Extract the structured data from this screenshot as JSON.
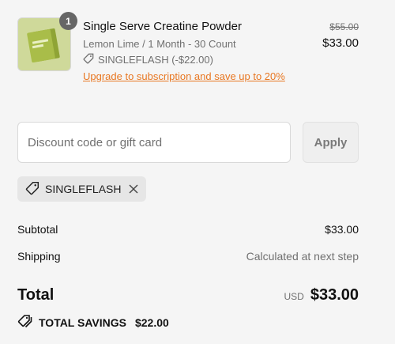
{
  "line_item": {
    "quantity_badge": "1",
    "title": "Single Serve Creatine Powder",
    "variant": "Lemon Lime / 1 Month - 30 Count",
    "discount_text": "SINGLEFLASH (-$22.00)",
    "upgrade_link": "Upgrade to subscription and save up to 20%",
    "original_price": "$55.00",
    "price": "$33.00"
  },
  "discount_form": {
    "placeholder": "Discount code or gift card",
    "value": "",
    "apply_label": "Apply"
  },
  "applied_code": {
    "code": "SINGLEFLASH"
  },
  "summary": {
    "subtotal_label": "Subtotal",
    "subtotal_value": "$33.00",
    "shipping_label": "Shipping",
    "shipping_value": "Calculated at next step",
    "total_label": "Total",
    "currency": "USD",
    "total_value": "$33.00",
    "savings_label": "TOTAL SAVINGS",
    "savings_value": "$22.00"
  },
  "colors": {
    "background": "#f5f5f5",
    "accent_link": "#e87722",
    "muted_text": "#707070"
  },
  "icons": {
    "discount_tag": "tag-icon",
    "chip_tag": "tag-icon",
    "chip_remove": "close-icon",
    "savings_tags": "tags-icon"
  }
}
